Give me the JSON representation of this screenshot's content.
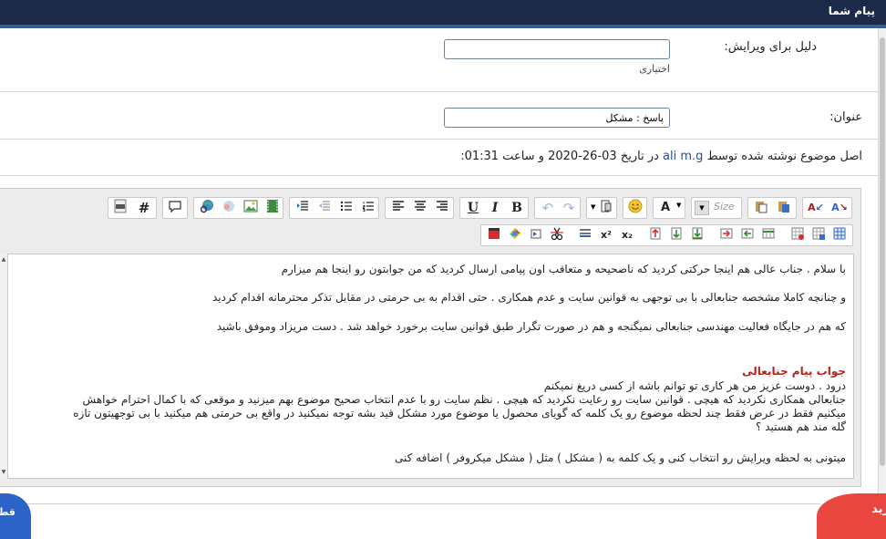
{
  "header": {
    "title": "پیام شما"
  },
  "form": {
    "edit_reason": {
      "label": "دلیل برای ویرایش:",
      "value": "",
      "hint": "اختیاری"
    },
    "subject": {
      "label": "عنوان:",
      "value": "پاسخ : مشکل"
    }
  },
  "meta": {
    "prefix": "اصل موضوع نوشته شده توسط",
    "author": "ali m.g",
    "date_part": "در تاریخ 03-26-2020 و ساعت 01:31:"
  },
  "toolbar": {
    "font_size_placeholder": "Size",
    "row1_icons": [
      "text-direction-rtl-icon",
      "text-direction-ltr-icon",
      "paste-icon",
      "paste-text-icon",
      "font-size-select",
      "font-color-icon",
      "smiley-icon",
      "insert-menu-icon",
      "redo-icon",
      "undo-icon",
      "bold-icon",
      "italic-icon",
      "underline-icon",
      "align-right-icon",
      "align-center-icon",
      "align-left-icon",
      "ordered-list-icon",
      "unordered-list-icon",
      "outdent-icon",
      "indent-icon",
      "link-icon",
      "unlink-icon",
      "image-icon",
      "video-icon",
      "quote-icon",
      "hash-tag-icon",
      "php-code-icon"
    ],
    "row1_glyphs": {
      "bold": "B",
      "italic": "I",
      "underline": "U",
      "hash": "#",
      "font_color": "A",
      "superscript": "x²",
      "subscript": "x₂"
    }
  },
  "editor": {
    "lines": [
      "با سلام . جناب عالی هم اینجا حرکتی کردید که ناصحیحه و متعاقب اون پیامی ارسال کردید که من جوابتون رو اینجا هم میزارم",
      "و چنانچه کاملا مشخصه جنابعالی با بی توجهی به قوانین سایت و عدم همکاری . حتی اقدام به بی حرمتی در مقابل تذکر محترمانه اقدام کردید",
      "که هم در جایگاه فعالیت مهندسی جنابعالی نمیگنجه و هم در صورت تگرار طبق قوانین سایت برخورد خواهد شد . دست مریزاد وموفق باشید"
    ],
    "reply_heading": "جواب پیام جنابعالی",
    "reply_lines": [
      "درود . دوست عزیز من هر کاری تو توانم باشه از کسی دریغ نمیکنم",
      "جنابعالی همکاری نکردید که هیچی . قوانین سایت رو رعایت نکردید که هیچی . نظم سایت رو با عدم انتخاب صحیح موضوع بهم میزنید و موقعی که با کمال احترام خواهش",
      "میکنیم فقط در عرض فقط چند لحظه موضوع رو یک کلمه که گویای محصول یا موضوع مورد مشکل قید بشه توجه نمیکنید در واقع بی حرمتی هم میکنید با بی توجهیتون تازه",
      "گله مند هم هستید ؟",
      "میتونی به لحظه ویرایش رو انتخاب کنی و یک کلمه به ( مشکل ) مثل ( مشکل میکروفر ) اضافه کنی"
    ]
  },
  "floating": {
    "buy_label": "خرید",
    "cut_label": "قط"
  },
  "colors": {
    "header_bg": "#1a2a48",
    "header_accent": "#3c5d8c",
    "link": "#2b4f86",
    "heading_red": "#b5221c",
    "buy_bg": "#e8463f",
    "cut_bg": "#2c63c9"
  }
}
